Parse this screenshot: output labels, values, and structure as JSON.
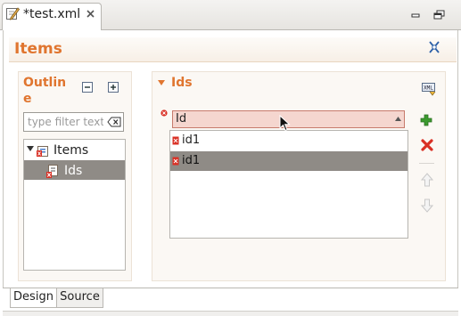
{
  "editor_tab": {
    "title": "*test.xml",
    "icon": "xml-editor-icon",
    "close_icon": "close-icon"
  },
  "window_controls": {
    "minimize_icon": "minimize-icon",
    "maximize_icon": "maximize-icon"
  },
  "form": {
    "title": "Items",
    "help_icon": "help-icon"
  },
  "outline": {
    "title": "Outline",
    "collapse_all_icon": "collapse-all-icon",
    "expand_all_icon": "expand-all-icon",
    "filter_placeholder": "type filter text",
    "clear_icon": "clear-filter-icon",
    "tree": [
      {
        "label": "Items",
        "expanded": true,
        "icon": "items-icon"
      },
      {
        "label": "Ids",
        "selected": true,
        "icon": "ids-error-icon"
      }
    ]
  },
  "ids_section": {
    "title": "Ids",
    "toolbar_icon": "xml-source-icon",
    "combo_value": "Id",
    "combo_invalid": true,
    "list": [
      {
        "label": "id1",
        "selected": false
      },
      {
        "label": "id1",
        "selected": true
      }
    ],
    "buttons": {
      "add_icon": "add-icon",
      "remove_icon": "remove-icon",
      "up_icon": "move-up-icon",
      "down_icon": "move-down-icon"
    }
  },
  "bottom_tabs": [
    {
      "label": "Design",
      "active": true
    },
    {
      "label": "Source",
      "active": false
    }
  ],
  "colors": {
    "section_title": "#e0752f",
    "selection": "#8f8b86",
    "invalid_field": "#f5d6cf",
    "error_red": "#d93025",
    "add_green": "#3c9a2f"
  }
}
